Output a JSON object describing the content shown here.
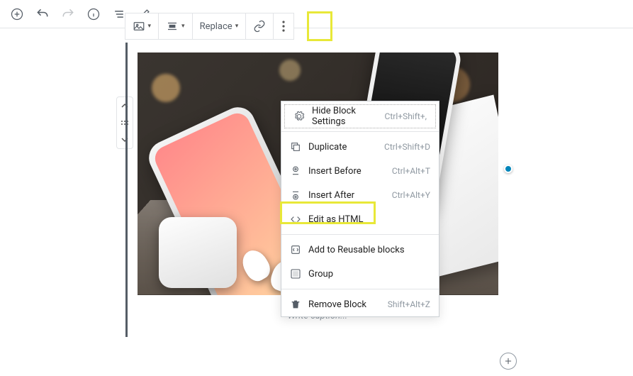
{
  "topToolbar": {
    "addBlock": "Add block",
    "undo": "Undo",
    "redo": "Redo",
    "info": "Content structure",
    "outline": "Block navigation",
    "edit": "Edit"
  },
  "blockToolbar": {
    "type": "Image",
    "align": "Align",
    "replaceLabel": "Replace",
    "link": "Link",
    "more": "More options"
  },
  "mover": {
    "up": "Move up",
    "drag": "Drag",
    "down": "Move down"
  },
  "menu": {
    "hideSettings": {
      "label": "Hide Block Settings",
      "shortcut": "Ctrl+Shift+,"
    },
    "duplicate": {
      "label": "Duplicate",
      "shortcut": "Ctrl+Shift+D"
    },
    "insertBefore": {
      "label": "Insert Before",
      "shortcut": "Ctrl+Alt+T"
    },
    "insertAfter": {
      "label": "Insert After",
      "shortcut": "Ctrl+Alt+Y"
    },
    "editHtml": {
      "label": "Edit as HTML",
      "shortcut": ""
    },
    "reusable": {
      "label": "Add to Reusable blocks",
      "shortcut": ""
    },
    "group": {
      "label": "Group",
      "shortcut": ""
    },
    "remove": {
      "label": "Remove Block",
      "shortcut": "Shift+Alt+Z"
    }
  },
  "caption": {
    "placeholder": "Write caption..."
  },
  "highlight": {
    "moreBtn": true,
    "editHtml": true
  },
  "addBelow": "Add block"
}
